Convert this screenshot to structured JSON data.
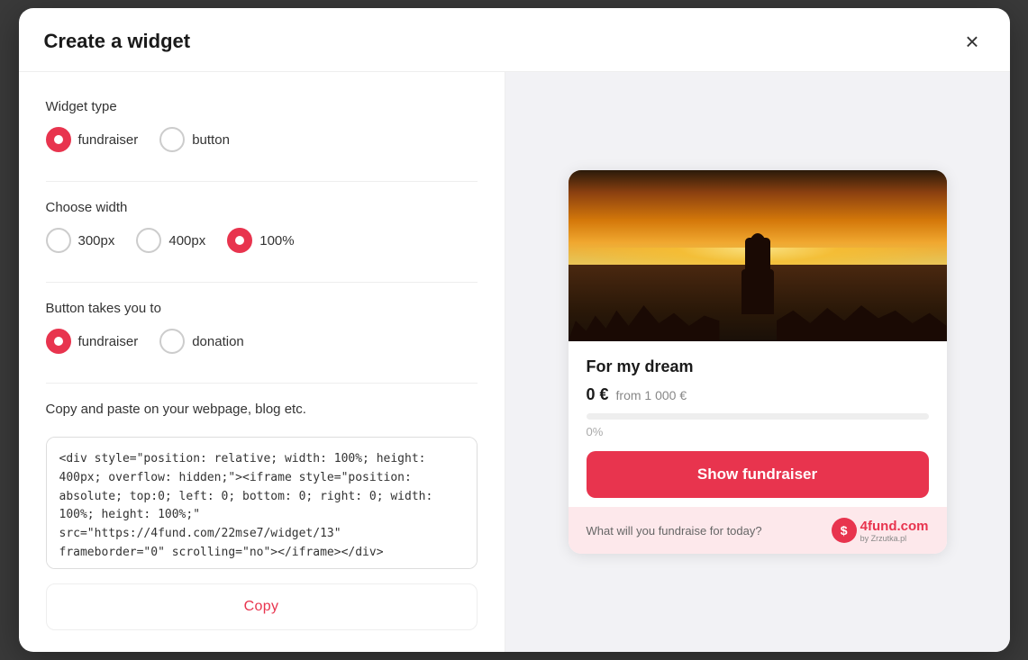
{
  "modal": {
    "title": "Create a widget",
    "close_label": "×"
  },
  "left": {
    "widget_type_label": "Widget type",
    "type_options": [
      {
        "id": "fundraiser",
        "label": "fundraiser",
        "active": true
      },
      {
        "id": "button",
        "label": "button",
        "active": false
      }
    ],
    "choose_width_label": "Choose width",
    "width_options": [
      {
        "id": "300px",
        "label": "300px",
        "active": false
      },
      {
        "id": "400px",
        "label": "400px",
        "active": false
      },
      {
        "id": "100pct",
        "label": "100%",
        "active": true
      }
    ],
    "button_takes_label": "Button takes you to",
    "destination_options": [
      {
        "id": "fundraiser",
        "label": "fundraiser",
        "active": true
      },
      {
        "id": "donation",
        "label": "donation",
        "active": false
      }
    ],
    "copy_paste_label": "Copy and paste on your webpage, blog etc.",
    "code_value": "<div style=\"position: relative; width: 100%; height: 400px; overflow: hidden;\"><iframe style=\"position: absolute; top:0; left: 0; bottom: 0; right: 0; width: 100%; height: 100%;\" src=\"https://4fund.com/22mse7/widget/13\" frameborder=\"0\" scrolling=\"no\"></iframe></div>",
    "copy_button_label": "Copy"
  },
  "right": {
    "preview": {
      "fundraiser_title": "For my dream",
      "amount_main": "0 €",
      "amount_from": "from 1 000 €",
      "progress_pct": 0,
      "progress_label": "0%",
      "show_button_label": "Show fundraiser",
      "footer_text": "What will you fundraise for today?",
      "logo_4fund": "4fund",
      "logo_com": ".com",
      "logo_by": "by Zrzutka.pl"
    }
  }
}
